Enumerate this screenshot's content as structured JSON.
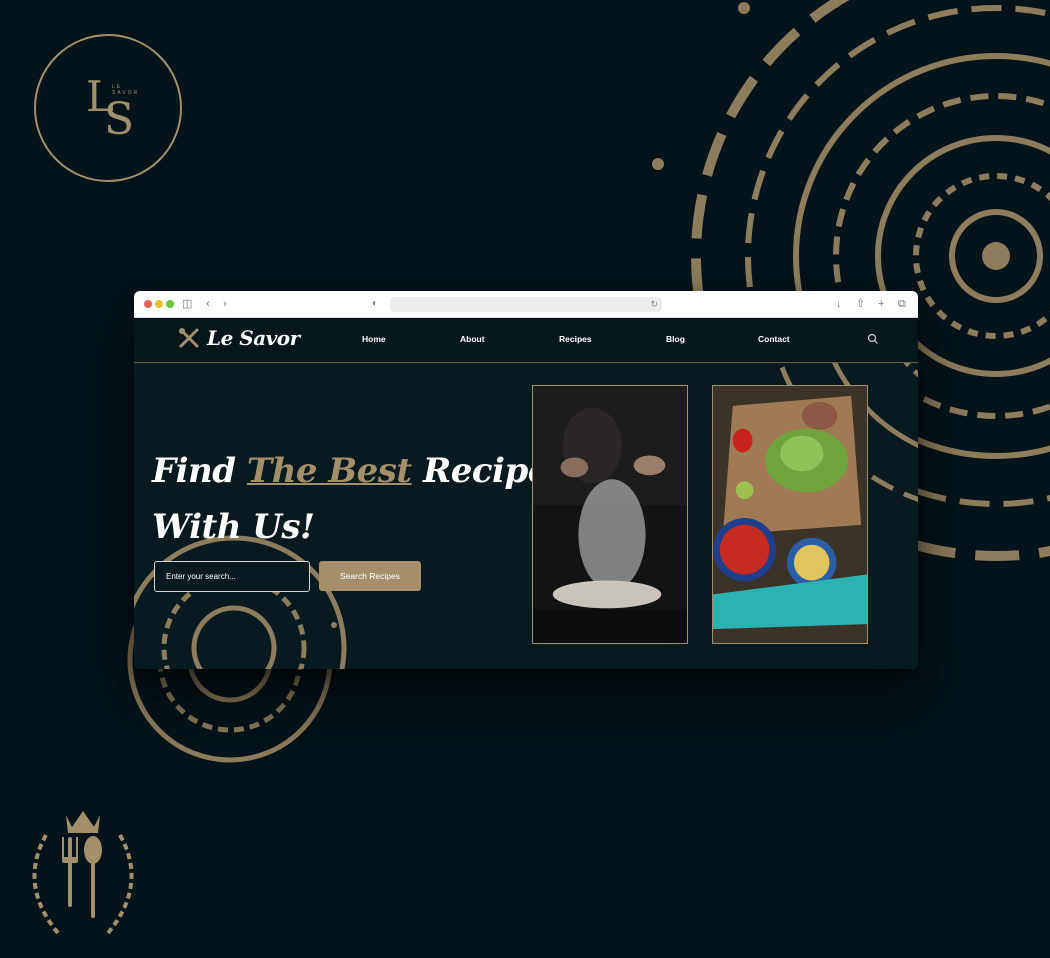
{
  "logo": {
    "monogram_l": "L",
    "monogram_s": "S",
    "tagline": "LE SAVOR"
  },
  "browser": {
    "url": ""
  },
  "site": {
    "brand": "Le Savor",
    "nav": [
      {
        "label": "Home"
      },
      {
        "label": "About"
      },
      {
        "label": "Recipes"
      },
      {
        "label": "Blog"
      },
      {
        "label": "Contact"
      }
    ],
    "hero": {
      "title_find": "Find",
      "title_accent": "The Best",
      "title_recipes": "Recipes",
      "title_line2": "With Us!"
    },
    "search": {
      "placeholder": "Enter your search...",
      "button_label": "Search Recipes"
    }
  },
  "colors": {
    "background": "#04141a",
    "accent": "#a38f6a",
    "text": "#ffffff"
  },
  "icons": [
    "crossed-utensils-icon",
    "search-icon",
    "crown-cutlery-crest"
  ]
}
